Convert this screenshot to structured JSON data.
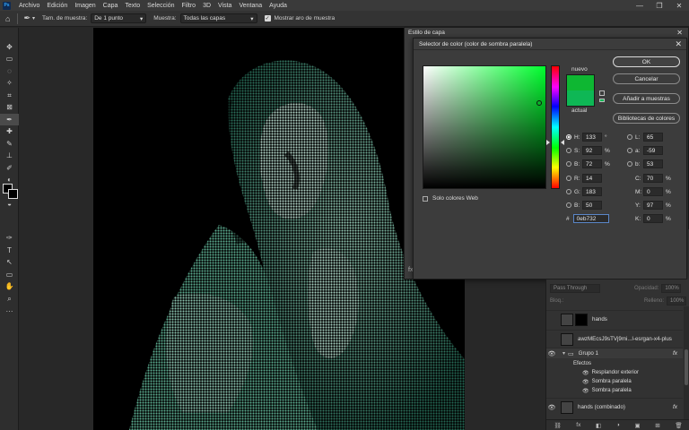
{
  "menubar": {
    "logo": "Ps",
    "items": [
      "Archivo",
      "Edición",
      "Imagen",
      "Capa",
      "Texto",
      "Selección",
      "Filtro",
      "3D",
      "Vista",
      "Ventana",
      "Ayuda"
    ],
    "win": [
      "—",
      "❐",
      "✕"
    ]
  },
  "options": {
    "home_glyph": "⌂",
    "tool_glyph": "✒",
    "sample_size_label": "Tam. de muestra:",
    "sample_size_value": "De 1 punto",
    "sample_label": "Muestra:",
    "sample_value": "Todas las capas",
    "show_ring_label": "Mostrar aro de muestra"
  },
  "toolbar": {
    "tools": [
      "✥",
      "▭",
      "◌",
      "✧",
      "⌗",
      "⊠",
      "✒",
      "✚",
      "✎",
      "⊥",
      "✐",
      "◐",
      "▮",
      "◒",
      "✑",
      "T",
      "↖",
      "▭",
      "✋",
      "⌕",
      "···"
    ]
  },
  "layer_style": {
    "title": "Estilo de capa",
    "close": "✕",
    "footer": [
      "fx",
      "⇧",
      "⇩",
      "🗑"
    ]
  },
  "picker": {
    "title": "Selector de color (color de sombra paralela)",
    "close": "✕",
    "new_label": "nuevo",
    "current_label": "actual",
    "new_color": "#0eb732",
    "current_color": "#0eb755",
    "buttons": {
      "ok": "OK",
      "cancel": "Cancelar",
      "add": "Añadir a muestras",
      "libraries": "Bibliotecas de colores"
    },
    "fields": {
      "H": "133",
      "S": "92",
      "B": "72",
      "R": "14",
      "G": "183",
      "Bc": "50",
      "L": "65",
      "a": "-59",
      "b": "53",
      "C": "70",
      "M": "0",
      "Y": "97",
      "K": "0"
    },
    "labels": {
      "H": "H:",
      "S": "S:",
      "B": "B:",
      "R": "R:",
      "G": "G:",
      "Bc": "B:",
      "L": "L:",
      "a": "a:",
      "b": "b:",
      "C": "C:",
      "M": "M:",
      "Y": "Y:",
      "K": "K:"
    },
    "units": {
      "deg": "°",
      "pct": "%"
    },
    "web_only": "Solo colores Web",
    "hex_symbol": "#",
    "hex": "0eb732"
  },
  "layers": {
    "blend_mode": "Pass Through",
    "opacity_label": "Opacidad:",
    "opacity": "100%",
    "lock_label": "Bloq.:",
    "fill_label": "Relleno:",
    "fill": "100%",
    "rows": {
      "hands": "hands",
      "upscaled": "awzMEcsJ9sTVj9mi...l-esrgan-x4-plus",
      "group": "Grupo 1",
      "effects": "Efectos",
      "outer_glow": "Resplandor exterior",
      "drop_shadow_1": "Sombra paralela",
      "drop_shadow_2": "Sombra paralela",
      "merged": "hands (combinado)"
    },
    "fx": "fx",
    "footer": [
      "⛓",
      "fx",
      "◧",
      "◑",
      "▣",
      "⊞",
      "🗑"
    ]
  }
}
